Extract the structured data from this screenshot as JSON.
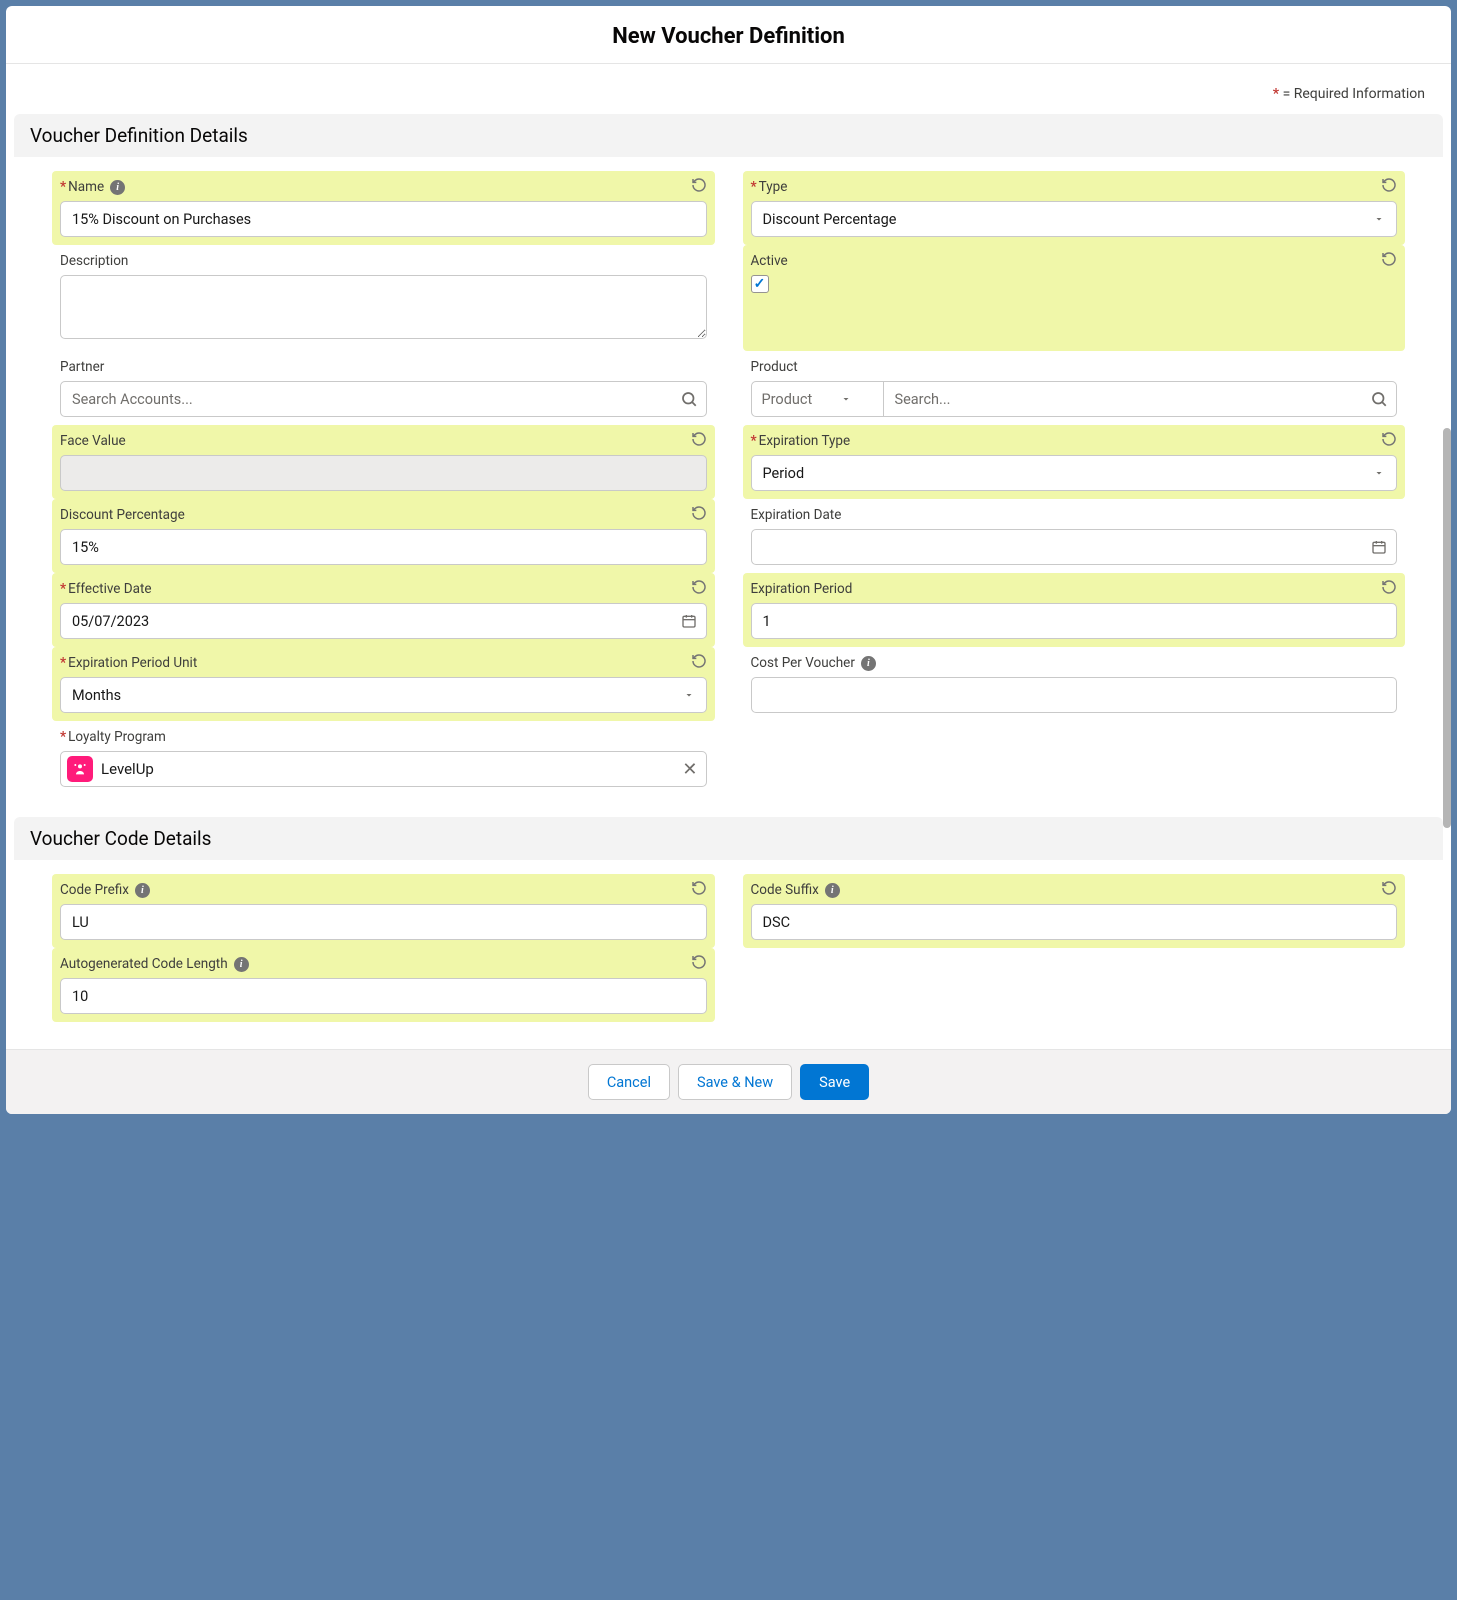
{
  "modalTitle": "New Voucher Definition",
  "requiredText": "= Required Information",
  "sections": {
    "details": "Voucher Definition Details",
    "code": "Voucher Code Details"
  },
  "fields": {
    "name": {
      "label": "Name",
      "value": "15% Discount on Purchases"
    },
    "type": {
      "label": "Type",
      "value": "Discount Percentage"
    },
    "description": {
      "label": "Description",
      "value": ""
    },
    "active": {
      "label": "Active"
    },
    "partner": {
      "label": "Partner",
      "placeholder": "Search Accounts..."
    },
    "product": {
      "label": "Product",
      "sel": "Product",
      "placeholder": "Search..."
    },
    "faceValue": {
      "label": "Face Value",
      "value": ""
    },
    "expType": {
      "label": "Expiration Type",
      "value": "Period"
    },
    "discountPct": {
      "label": "Discount Percentage",
      "value": "15%"
    },
    "expDate": {
      "label": "Expiration Date",
      "value": ""
    },
    "effDate": {
      "label": "Effective Date",
      "value": "05/07/2023"
    },
    "expPeriod": {
      "label": "Expiration Period",
      "value": "1"
    },
    "expUnit": {
      "label": "Expiration Period Unit",
      "value": "Months"
    },
    "costPer": {
      "label": "Cost Per Voucher",
      "value": ""
    },
    "loyalty": {
      "label": "Loyalty Program",
      "value": "LevelUp"
    },
    "codePrefix": {
      "label": "Code Prefix",
      "value": "LU"
    },
    "codeSuffix": {
      "label": "Code Suffix",
      "value": "DSC"
    },
    "codeLen": {
      "label": "Autogenerated Code Length",
      "value": "10"
    }
  },
  "buttons": {
    "cancel": "Cancel",
    "saveNew": "Save & New",
    "save": "Save"
  }
}
